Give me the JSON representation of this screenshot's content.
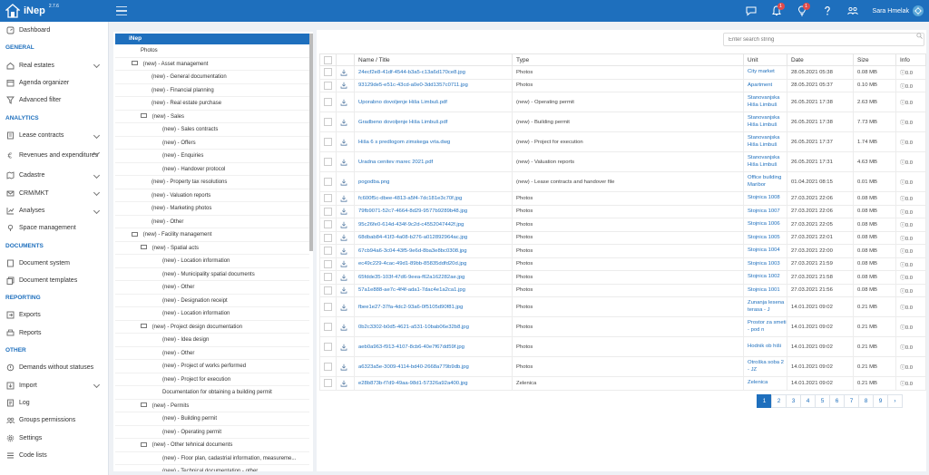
{
  "app": {
    "brand": "iNep",
    "version": "2.7.6"
  },
  "topbar": {
    "notifications_count": "1",
    "ideas_count": "1",
    "user_name": "Sara Hmelak"
  },
  "sidebar": {
    "items": [
      {
        "id": "dashboard",
        "label": "Dashboard"
      },
      {
        "section": "GENERAL"
      },
      {
        "id": "real-estates",
        "label": "Real estates",
        "chevron": true
      },
      {
        "id": "agenda-organizer",
        "label": "Agenda organizer"
      },
      {
        "id": "advanced-filter",
        "label": "Advanced filter"
      },
      {
        "section": "ANALYTICS"
      },
      {
        "id": "lease-contracts",
        "label": "Lease contracts",
        "chevron": true
      },
      {
        "id": "revenues-expenditures",
        "label": "Revenues and expenditures",
        "chevron": true
      },
      {
        "id": "cadastre",
        "label": "Cadastre",
        "chevron": true
      },
      {
        "id": "crm-mkt",
        "label": "CRM/MKT",
        "chevron": true
      },
      {
        "id": "analyses",
        "label": "Analyses",
        "chevron": true
      },
      {
        "id": "space-management",
        "label": "Space management"
      },
      {
        "section": "DOCUMENTS"
      },
      {
        "id": "document-system",
        "label": "Document system"
      },
      {
        "id": "document-templates",
        "label": "Document templates"
      },
      {
        "section": "REPORTING"
      },
      {
        "id": "exports",
        "label": "Exports"
      },
      {
        "id": "reports",
        "label": "Reports"
      },
      {
        "section": "OTHER"
      },
      {
        "id": "demands",
        "label": "Demands without statuses"
      },
      {
        "id": "import",
        "label": "Import",
        "chevron": true
      },
      {
        "id": "log",
        "label": "Log"
      },
      {
        "id": "groups-permissions",
        "label": "Groups permissions"
      },
      {
        "id": "settings",
        "label": "Settings"
      },
      {
        "id": "code-lists",
        "label": "Code lists"
      }
    ]
  },
  "tree": {
    "header": "iNep",
    "rows": [
      {
        "label": "Photos",
        "indent": 0,
        "folder": false
      },
      {
        "label": "(new) - Asset management",
        "indent": 1,
        "folder": true
      },
      {
        "label": "(new) - General documentation",
        "indent": 3,
        "folder": false
      },
      {
        "label": "(new) - Financial planning",
        "indent": 3,
        "folder": false
      },
      {
        "label": "(new) - Real estate purchase",
        "indent": 3,
        "folder": false
      },
      {
        "label": "(new) - Sales",
        "indent": 2,
        "folder": true
      },
      {
        "label": "(new) - Sales contracts",
        "indent": 4,
        "folder": false
      },
      {
        "label": "(new) - Offers",
        "indent": 4,
        "folder": false
      },
      {
        "label": "(new) - Enquiries",
        "indent": 4,
        "folder": false
      },
      {
        "label": "(new) - Handover protocol",
        "indent": 4,
        "folder": false
      },
      {
        "label": "(new) - Property tax resolutions",
        "indent": 3,
        "folder": false
      },
      {
        "label": "(new) - Valuation reports",
        "indent": 3,
        "folder": false
      },
      {
        "label": "(new) - Marketing photos",
        "indent": 3,
        "folder": false
      },
      {
        "label": "(new) - Other",
        "indent": 3,
        "folder": false
      },
      {
        "label": "(new) - Facility management",
        "indent": 1,
        "folder": true
      },
      {
        "label": "(new) - Spatial acts",
        "indent": 2,
        "folder": true
      },
      {
        "label": "(new) - Location information",
        "indent": 4,
        "folder": false
      },
      {
        "label": "(new) - Municipality spatial documents",
        "indent": 4,
        "folder": false
      },
      {
        "label": "(new) - Other",
        "indent": 4,
        "folder": false
      },
      {
        "label": "(new) - Designation receipt",
        "indent": 4,
        "folder": false
      },
      {
        "label": "(new) - Location information",
        "indent": 4,
        "folder": false
      },
      {
        "label": "(new) - Project design documentation",
        "indent": 2,
        "folder": true
      },
      {
        "label": "(new) - Idea design",
        "indent": 4,
        "folder": false
      },
      {
        "label": "(new) - Other",
        "indent": 4,
        "folder": false
      },
      {
        "label": "(new) - Project of works performed",
        "indent": 4,
        "folder": false
      },
      {
        "label": "(new) - Project for execution",
        "indent": 4,
        "folder": false
      },
      {
        "label": "Documentation for obtaining a building permit",
        "indent": 4,
        "folder": false
      },
      {
        "label": "(new) - Permits",
        "indent": 2,
        "folder": true
      },
      {
        "label": "(new) - Building permit",
        "indent": 4,
        "folder": false
      },
      {
        "label": "(new) - Operating permit",
        "indent": 4,
        "folder": false
      },
      {
        "label": "(new) - Other tehnical documents",
        "indent": 2,
        "folder": true
      },
      {
        "label": "(new) - Floor plan, cadastrial information, measureme...",
        "indent": 4,
        "folder": false
      },
      {
        "label": "(new) - Technical documentation - other",
        "indent": 4,
        "folder": false
      }
    ]
  },
  "search": {
    "placeholder": "Enter search string"
  },
  "table": {
    "headers": [
      "Name / Title",
      "Type",
      "Unit",
      "Date",
      "Size",
      "Info"
    ],
    "rows": [
      {
        "name": "24ecf2e8-41df-4544-b3a5-c13a6d170ce8.jpg",
        "type": "Photos",
        "unit": "City market",
        "date": "28.05.2021 05:38",
        "size": "0.08 MB",
        "info": "0.0",
        "h": "n"
      },
      {
        "name": "93129de5-e51c-43cd-a0e0-3dd1357c0711.jpg",
        "type": "Photos",
        "unit": "Apartment",
        "date": "28.05.2021 05:37",
        "size": "0.10 MB",
        "info": "0.0",
        "h": "n"
      },
      {
        "name": "Uporabno dovoljenje Hiša Limbuš.pdf",
        "type": "(new) - Operating permit",
        "unit": "Stanovanjska Hiša Limbuš",
        "date": "26.05.2021 17:38",
        "size": "2.63 MB",
        "info": "0.0",
        "h": "t"
      },
      {
        "name": "Gradbeno dovoljenje Hiša Limbuš.pdf",
        "type": "(new) - Building permit",
        "unit": "Stanovanjska Hiša Limbuš",
        "date": "26.05.2021 17:38",
        "size": "7.73 MB",
        "info": "0.0",
        "h": "t"
      },
      {
        "name": "Hiša 6 s predlogom zimskega vrta.dwg",
        "type": "(new) - Project for execution",
        "unit": "Stanovanjska Hiša Limbuš",
        "date": "26.05.2021 17:37",
        "size": "1.74 MB",
        "info": "0.0",
        "h": "t"
      },
      {
        "name": "Uradna cenitev marec 2021.pdf",
        "type": "(new) - Valuation reports",
        "unit": "Stanovanjska Hiša Limbuš",
        "date": "26.05.2021 17:31",
        "size": "4.63 MB",
        "info": "0.0",
        "h": "t"
      },
      {
        "name": "pogodba.png",
        "type": "(new) - Lease contracts and handover file",
        "unit": "Office building Maribor",
        "date": "01.04.2021 08:15",
        "size": "0.01 MB",
        "info": "0.0",
        "h": "t"
      },
      {
        "name": "fc600f5c-dbee-4813-a5f4-7dc181e3c70f.jpg",
        "type": "Photos",
        "unit": "Stojnica 1008",
        "date": "27.03.2021 22:06",
        "size": "0.08 MB",
        "info": "0.0",
        "h": "n"
      },
      {
        "name": "79fb9071-52c7-4664-8d29-9577b9289b48.jpg",
        "type": "Photos",
        "unit": "Stojnica 1007",
        "date": "27.03.2021 22:06",
        "size": "0.08 MB",
        "info": "0.0",
        "h": "n"
      },
      {
        "name": "95c26fe0-614d-434f-9c2d-c4552047442f.jpg",
        "type": "Photos",
        "unit": "Stojnica 1006",
        "date": "27.03.2021 22:05",
        "size": "0.08 MB",
        "info": "0.0",
        "h": "n"
      },
      {
        "name": "68dbab84-41f3-4a08-b276-a012892964ac.jpg",
        "type": "Photos",
        "unit": "Stojnica 1005",
        "date": "27.03.2021 22:01",
        "size": "0.08 MB",
        "info": "0.0",
        "h": "n"
      },
      {
        "name": "67cb94a6-3c04-43f5-9e6d-8ba3e8bc0308.jpg",
        "type": "Photos",
        "unit": "Stojnica 1004",
        "date": "27.03.2021 22:00",
        "size": "0.08 MB",
        "info": "0.0",
        "h": "n"
      },
      {
        "name": "ec49c229-4cac-49d1-89bb-85835ddfd20d.jpg",
        "type": "Photos",
        "unit": "Stojnica 1003",
        "date": "27.03.2021 21:59",
        "size": "0.08 MB",
        "info": "0.0",
        "h": "n"
      },
      {
        "name": "65fdde35-103f-47d6-9eea-f62a162282ae.jpg",
        "type": "Photos",
        "unit": "Stojnica 1002",
        "date": "27.03.2021 21:58",
        "size": "0.08 MB",
        "info": "0.0",
        "h": "n"
      },
      {
        "name": "57a1e888-ae7c-4f4f-ada1-7dac4e1a2ca1.jpg",
        "type": "Photos",
        "unit": "Stojnica 1001",
        "date": "27.03.2021 21:56",
        "size": "0.08 MB",
        "info": "0.0",
        "h": "n"
      },
      {
        "name": "fbee1e27-37fa-4dc2-93a6-0f5105d90f81.jpg",
        "type": "Photos",
        "unit": "Zunanja lesena terasa - J",
        "date": "14.01.2021 09:02",
        "size": "0.21 MB",
        "info": "0.0",
        "h": "t3"
      },
      {
        "name": "0b2c3302-b0d5-4621-a531-10bab06e32b8.jpg",
        "type": "Photos",
        "unit": "Prostor za smeti - pod n",
        "date": "14.01.2021 09:02",
        "size": "0.21 MB",
        "info": "0.0",
        "h": "t"
      },
      {
        "name": "aeb0a963-f913-4107-8cb6-40e7f67dd59f.jpg",
        "type": "Photos",
        "unit": "Hodnik ob hiši",
        "date": "14.01.2021 09:02",
        "size": "0.21 MB",
        "info": "0.0",
        "h": "t"
      },
      {
        "name": "a6323a5e-3009-4114-bd40-2668a779b9db.jpg",
        "type": "Photos",
        "unit": "Otroška soba 2 - JZ",
        "date": "14.01.2021 09:02",
        "size": "0.21 MB",
        "info": "0.0",
        "h": "t"
      },
      {
        "name": "e28b873b-f7d9-49aa-98d1-57326a92a400.jpg",
        "type": "Zelenica",
        "unit": "Zelenica",
        "date": "14.01.2021 09:02",
        "size": "0.21 MB",
        "info": "0.0",
        "h": "n"
      }
    ]
  },
  "pagination": {
    "pages": [
      "1",
      "2",
      "3",
      "4",
      "5",
      "6",
      "7",
      "8",
      "9"
    ],
    "active": "1",
    "next": "›"
  }
}
